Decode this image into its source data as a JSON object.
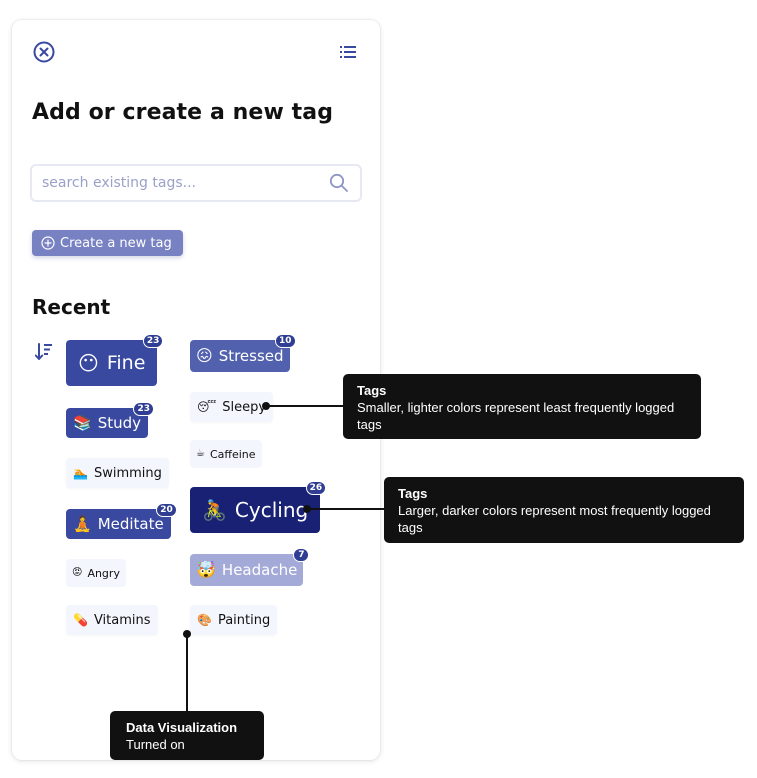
{
  "panel": {
    "title": "Add or create a new tag",
    "close_icon": "close-circle-icon",
    "list_icon": "list-view-icon",
    "search": {
      "placeholder": "search existing tags...",
      "value": "",
      "icon": "search-icon"
    },
    "create_button": {
      "label": "Create a new tag",
      "icon": "plus-circle-icon"
    },
    "recent": {
      "title": "Recent",
      "sort_icon": "sort-descending-icon",
      "tags": [
        {
          "id": "fine",
          "emoji": "😶",
          "label": "Fine",
          "count": "23"
        },
        {
          "id": "stressed",
          "emoji": "😖",
          "label": "Stressed",
          "count": "10"
        },
        {
          "id": "sleepy",
          "emoji": "😴",
          "label": "Sleepy",
          "count": ""
        },
        {
          "id": "study",
          "emoji": "📚",
          "label": "Study",
          "count": "23"
        },
        {
          "id": "caffeine",
          "emoji": "☕",
          "label": "Caffeine",
          "count": ""
        },
        {
          "id": "swimming",
          "emoji": "🏊",
          "label": "Swimming",
          "count": ""
        },
        {
          "id": "cycling",
          "emoji": "🚴",
          "label": "Cycling",
          "count": "26"
        },
        {
          "id": "meditate",
          "emoji": "🧘",
          "label": "Meditate",
          "count": "20"
        },
        {
          "id": "headache",
          "emoji": "🤯",
          "label": "Headache",
          "count": "7"
        },
        {
          "id": "angry",
          "emoji": "😡",
          "label": "Angry",
          "count": ""
        },
        {
          "id": "vitamins",
          "emoji": "💊",
          "label": "Vitamins",
          "count": ""
        },
        {
          "id": "painting",
          "emoji": "🎨",
          "label": "Painting",
          "count": ""
        }
      ]
    }
  },
  "colors": {
    "accent": "#3a49a0",
    "darkest_tag": "#182173",
    "light_tag": "#a3aad8",
    "least_tag_bg": "#f4f6fe",
    "badge": "#2f3d92",
    "callout_bg": "#111111"
  },
  "annotations": [
    {
      "id": "light-tags",
      "title": "Tags",
      "body": "Smaller, lighter colors represent least frequently logged tags"
    },
    {
      "id": "dark-tags",
      "title": "Tags",
      "body": "Larger, darker colors represent most frequently logged tags"
    },
    {
      "id": "data-viz",
      "title": "Data Visualization",
      "body": "Turned on"
    }
  ]
}
